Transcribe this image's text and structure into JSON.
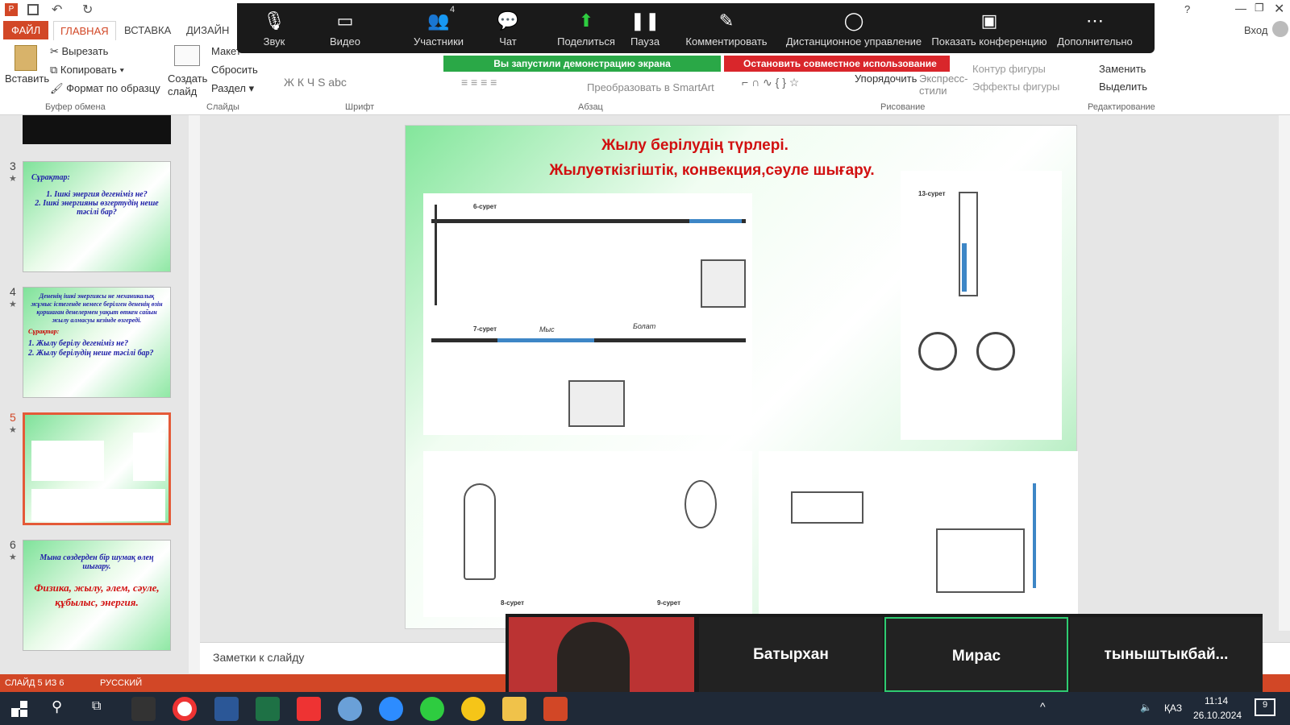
{
  "qat": {
    "help": "?",
    "login": "Вход"
  },
  "tabs": {
    "file": "ФАЙЛ",
    "home": "ГЛАВНАЯ",
    "insert": "ВСТАВКА",
    "design": "ДИЗАЙН"
  },
  "ribbon": {
    "paste": "Вставить",
    "cut": "Вырезать",
    "copy": "Копировать",
    "format_painter": "Формат по образцу",
    "clipboard": "Буфер обмена",
    "new_slide": "Создать слайд",
    "layout": "Макет",
    "reset": "Сбросить",
    "section": "Раздел",
    "slides": "Слайды",
    "font_group": "Шрифт",
    "paragraph_group": "Абзац",
    "smartart": "Преобразовать в SmartArt",
    "arrange": "Упорядочить",
    "quick_styles": "Экспресс-стили",
    "shape_outline": "Контур фигуры",
    "shape_effects": "Эффекты фигуры",
    "drawing": "Рисование",
    "replace": "Заменить",
    "select": "Выделить",
    "editing": "Редактирование"
  },
  "zoom": {
    "items": [
      {
        "label": "Звук",
        "icon": "microphone-icon"
      },
      {
        "label": "Видео",
        "icon": "camera-icon"
      },
      {
        "label": "Участники",
        "icon": "participants-icon",
        "badge": "4"
      },
      {
        "label": "Чат",
        "icon": "chat-icon"
      },
      {
        "label": "Поделиться",
        "icon": "share-icon"
      },
      {
        "label": "Пауза",
        "icon": "pause-icon"
      },
      {
        "label": "Комментировать",
        "icon": "pen-icon"
      },
      {
        "label": "Дистанционное управление",
        "icon": "mouse-icon"
      },
      {
        "label": "Показать конференцию",
        "icon": "show-meeting-icon"
      },
      {
        "label": "Дополнительно",
        "icon": "more-icon"
      }
    ],
    "share_banner": "Вы запустили демонстрацию экрана",
    "stop_share": "Остановить совместное использование",
    "participants": [
      "Батырхан",
      "Мирас",
      "тыныштыкбай..."
    ]
  },
  "thumbs": [
    {
      "num": "3",
      "question_head": "Сұрақтар:",
      "lines": [
        "1. Ішкі энергия дегеніміз не?",
        "2. Ішкі энергияны өзгертудің неше тәсілі бар?"
      ]
    },
    {
      "num": "4",
      "text": "Дененің ішкі энергиясы не механикалық жұмыс істегенде немесе берілген дененің өзін қоршаған денелермен уақыт өткен сайын жылу алмасуы кезінде өзгереді.",
      "question_head": "Сұрақтар:",
      "lines": [
        "1. Жылу берілу дегеніміз не?",
        "2. Жылу берілудің неше тәсілі бар?"
      ]
    },
    {
      "num": "5"
    },
    {
      "num": "6",
      "line1": "Мына сөздерден бір шумақ өлең шығару.",
      "line2": "Физика, жылу, әлем, сәуле, құбылыс, энергия."
    }
  ],
  "slide": {
    "title1": "Жылу берілудің түрлері.",
    "title2": "Жылуөткізгіштік, конвекция,сәуле шығару.",
    "fig6": "6-сурет",
    "fig7": "7-сурет",
    "copper": "Мыс",
    "steel": "Болат",
    "fig13": "13-сурет",
    "fig8": "8-сурет",
    "fig9": "9-сурет"
  },
  "notes": "Заметки к слайду",
  "status": {
    "slide": "СЛАЙД 5 ИЗ 6",
    "lang": "РУССКИЙ"
  },
  "tray": {
    "lang": "ҚАЗ",
    "time": "11:14",
    "date": "26.10.2024",
    "notif": "9"
  }
}
